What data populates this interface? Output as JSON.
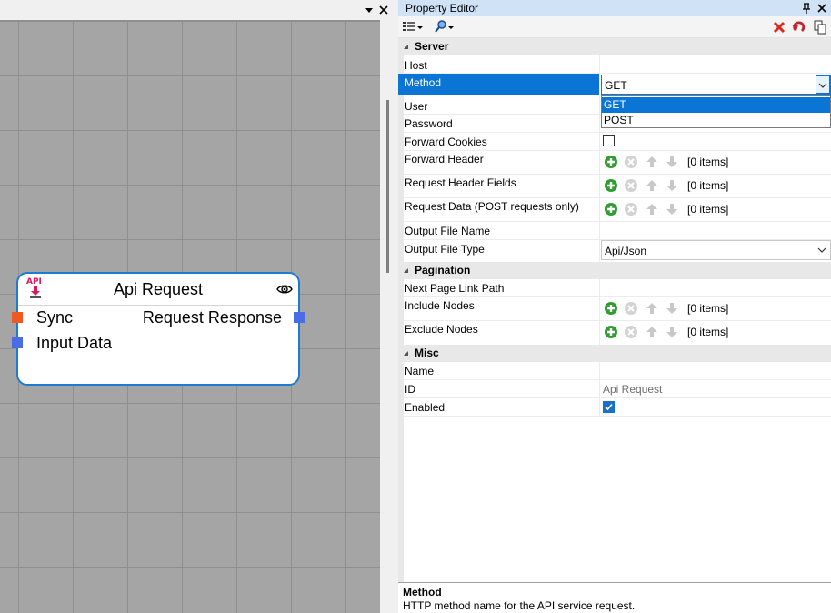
{
  "canvas": {
    "topbar_icons": [
      "chevron-down-icon",
      "close-icon"
    ],
    "node": {
      "title": "Api Request",
      "icon_text": "API",
      "inputs": [
        {
          "label": "Sync",
          "color": "#f05a22"
        },
        {
          "label": "Input Data",
          "color": "#4a6de5"
        }
      ],
      "outputs": [
        {
          "label": "Request Response",
          "color": "#4a6de5"
        }
      ]
    }
  },
  "property_editor": {
    "title": "Property Editor",
    "categories": [
      {
        "label": "Server",
        "properties": [
          {
            "name": "Host",
            "value": ""
          },
          {
            "name": "Method",
            "value": "GET",
            "type": "dropdown",
            "selected": true
          },
          {
            "name": "User",
            "value": ""
          },
          {
            "name": "Password",
            "value": ""
          },
          {
            "name": "Forward Cookies",
            "type": "checkbox",
            "checked": false
          },
          {
            "name": "Forward Header",
            "type": "collection",
            "value": "[0 items]"
          },
          {
            "name": "Request Header Fields",
            "type": "collection",
            "value": "[0 items]"
          },
          {
            "name": "Request Data (POST requests only)",
            "type": "collection",
            "value": "[0 items]"
          },
          {
            "name": "Output File Name",
            "value": ""
          },
          {
            "name": "Output File Type",
            "value": "Api/Json",
            "type": "dropdown"
          }
        ]
      },
      {
        "label": "Pagination",
        "properties": [
          {
            "name": "Next Page Link Path",
            "value": ""
          },
          {
            "name": "Include Nodes",
            "type": "collection",
            "value": "[0 items]"
          },
          {
            "name": "Exclude Nodes",
            "type": "collection",
            "value": "[0 items]"
          }
        ]
      },
      {
        "label": "Misc",
        "properties": [
          {
            "name": "Name",
            "value": ""
          },
          {
            "name": "ID",
            "value": "Api Request"
          },
          {
            "name": "Enabled",
            "type": "checkbox",
            "checked": true
          }
        ]
      }
    ],
    "method_options": [
      "GET",
      "POST"
    ],
    "method_selected_option": "GET",
    "description": {
      "title": "Method",
      "text": "HTTP method name for the API service request."
    },
    "colors": {
      "selection": "#0b75d6",
      "titlebar": "#cfe2f6",
      "node_border": "#1e7bd2"
    }
  }
}
